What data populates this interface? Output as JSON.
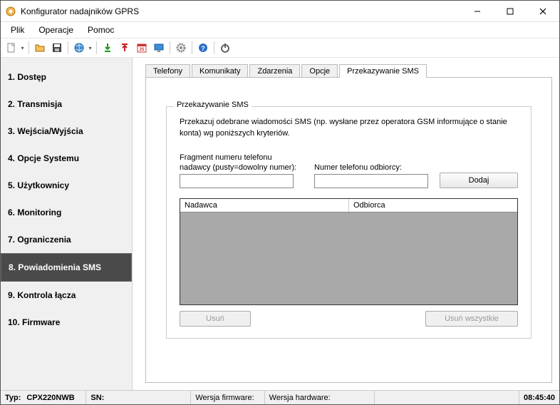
{
  "window": {
    "title": "Konfigurator nadajników GPRS"
  },
  "menu": {
    "file": "Plik",
    "operations": "Operacje",
    "help": "Pomoc"
  },
  "sidebar": {
    "items": [
      {
        "label": "1. Dostęp"
      },
      {
        "label": "2. Transmisja"
      },
      {
        "label": "3. Wejścia/Wyjścia"
      },
      {
        "label": "4. Opcje Systemu"
      },
      {
        "label": "5. Użytkownicy"
      },
      {
        "label": "6. Monitoring"
      },
      {
        "label": "7. Ograniczenia"
      },
      {
        "label": "8. Powiadomienia SMS"
      },
      {
        "label": "9. Kontrola łącza"
      },
      {
        "label": "10. Firmware"
      }
    ],
    "active_index": 7
  },
  "tabs": {
    "items": [
      {
        "label": "Telefony"
      },
      {
        "label": "Komunikaty"
      },
      {
        "label": "Zdarzenia"
      },
      {
        "label": "Opcje"
      },
      {
        "label": "Przekazywanie SMS"
      }
    ],
    "active_index": 4
  },
  "group": {
    "legend": "Przekazywanie SMS",
    "desc": "Przekazuj odebrane wiadomości SMS (np. wysłane przez operatora GSM informujące o stanie konta) wg poniższych kryteriów.",
    "sender_label": "Fragment numeru telefonu nadawcy (pusty=dowolny numer):",
    "recipient_label": "Numer telefonu odbiorcy:",
    "sender_value": "",
    "recipient_value": "",
    "add_button": "Dodaj",
    "col_sender": "Nadawca",
    "col_recipient": "Odbiorca",
    "delete_button": "Usuń",
    "delete_all_button": "Usuń wszystkie"
  },
  "status": {
    "type_label": "Typ:",
    "type_value": "CPX220NWB",
    "sn_label": "SN:",
    "sn_value": "",
    "fw_label": "Wersja firmware:",
    "fw_value": "",
    "hw_label": "Wersja hardware:",
    "hw_value": "",
    "time": "08:45:40"
  }
}
